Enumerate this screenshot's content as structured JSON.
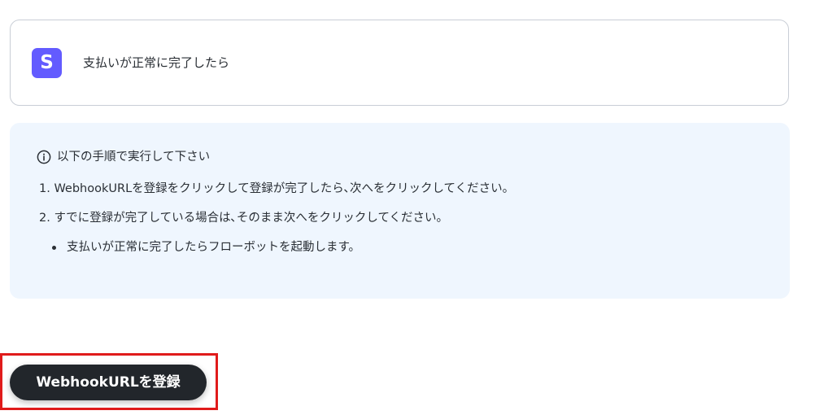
{
  "trigger": {
    "app_icon_letter": "S",
    "label": "支払いが正常に完了したら"
  },
  "info": {
    "title": "以下の手順で実行して下さい",
    "steps": [
      "1. WebhookURLを登録をクリックして登録が完了したら､次へをクリックしてください。",
      "2. すでに登録が完了している場合は､そのまま次へをクリックしてください。"
    ],
    "bullet": "支払いが正常に完了したらフローボットを起動します。"
  },
  "actions": {
    "register_label": "WebhookURLを登録"
  },
  "colors": {
    "app_icon_bg": "#635bff",
    "info_bg": "#eff6fe",
    "button_bg": "#22262b",
    "highlight_border": "#e01b1b"
  }
}
